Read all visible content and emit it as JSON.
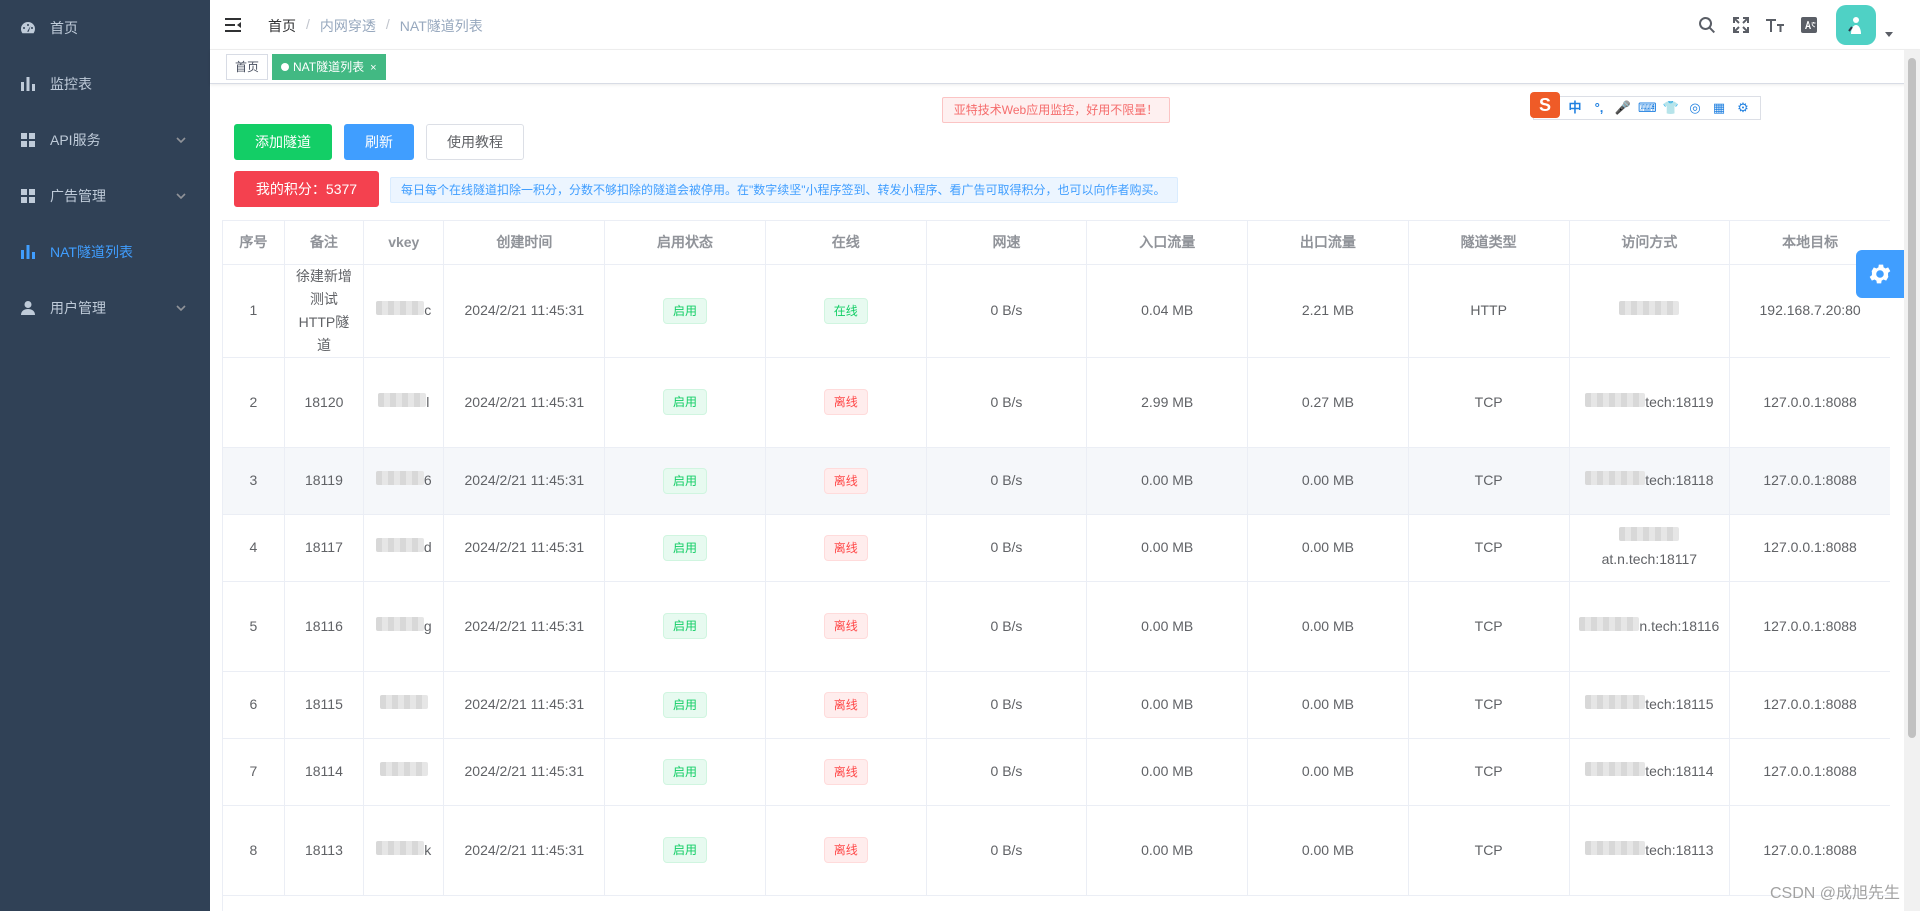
{
  "sidebar": {
    "items": [
      {
        "label": "首页",
        "icon": "dashboard-icon",
        "has_children": false,
        "active": false
      },
      {
        "label": "监控表",
        "icon": "bar-chart-icon",
        "has_children": false,
        "active": false
      },
      {
        "label": "API服务",
        "icon": "grid-icon",
        "has_children": true,
        "active": false
      },
      {
        "label": "广告管理",
        "icon": "grid-icon",
        "has_children": true,
        "active": false
      },
      {
        "label": "NAT隧道列表",
        "icon": "bar-chart-icon",
        "has_children": false,
        "active": true
      },
      {
        "label": "用户管理",
        "icon": "user-icon",
        "has_children": true,
        "active": false
      }
    ]
  },
  "header": {
    "breadcrumb": [
      "首页",
      "内网穿透",
      "NAT隧道列表"
    ],
    "tools": [
      "search-icon",
      "fullscreen-icon",
      "font-size-icon",
      "translate-icon"
    ]
  },
  "tags": [
    {
      "label": "首页",
      "active": false
    },
    {
      "label": "NAT隧道列表",
      "active": true,
      "close": "×"
    }
  ],
  "notices": {
    "ad": "亚特技术Web应用监控，好用不限量！",
    "info": "每日每个在线隧道扣除一积分，分数不够扣除的隧道会被停用。在\"数字续坚\"小程序签到、转发小程序、看广告可取得积分，也可以向作者购买。"
  },
  "ime": {
    "logo": "S",
    "items": [
      "中",
      "°,",
      "🎤",
      "⌨",
      "👕",
      "◎",
      "▦",
      "⚙"
    ]
  },
  "toolbar": {
    "add_label": "添加隧道",
    "refresh_label": "刷新",
    "tutorial_label": "使用教程",
    "points_label": "我的积分：5377"
  },
  "table": {
    "columns": [
      "序号",
      "备注",
      "vkey",
      "创建时间",
      "启用状态",
      "在线",
      "网速",
      "入口流量",
      "出口流量",
      "隧道类型",
      "访问方式",
      "本地目标"
    ],
    "rows": [
      {
        "index": "1",
        "remark": "徐建新增测试HTTP隧道",
        "vkey": "c",
        "created": "2024/2/21 11:45:31",
        "enabled": "启用",
        "online": "在线",
        "online_ok": true,
        "speed": "0 B/s",
        "in": "0.04 MB",
        "out": "2.21 MB",
        "type": "HTTP",
        "access": "",
        "target": "192.168.7.20:80"
      },
      {
        "index": "2",
        "remark": "18120",
        "vkey": "l",
        "created": "2024/2/21 11:45:31",
        "enabled": "启用",
        "online": "离线",
        "online_ok": false,
        "speed": "0 B/s",
        "in": "2.99 MB",
        "out": "0.27 MB",
        "type": "TCP",
        "access": "tech:18119",
        "target": "127.0.0.1:8088"
      },
      {
        "index": "3",
        "remark": "18119",
        "vkey": "6",
        "created": "2024/2/21 11:45:31",
        "enabled": "启用",
        "online": "离线",
        "online_ok": false,
        "speed": "0 B/s",
        "in": "0.00 MB",
        "out": "0.00 MB",
        "type": "TCP",
        "access": "tech:18118",
        "target": "127.0.0.1:8088"
      },
      {
        "index": "4",
        "remark": "18117",
        "vkey": "d",
        "created": "2024/2/21 11:45:31",
        "enabled": "启用",
        "online": "离线",
        "online_ok": false,
        "speed": "0 B/s",
        "in": "0.00 MB",
        "out": "0.00 MB",
        "type": "TCP",
        "access": "at.n.tech:18117",
        "target": "127.0.0.1:8088"
      },
      {
        "index": "5",
        "remark": "18116",
        "vkey": "g",
        "created": "2024/2/21 11:45:31",
        "enabled": "启用",
        "online": "离线",
        "online_ok": false,
        "speed": "0 B/s",
        "in": "0.00 MB",
        "out": "0.00 MB",
        "type": "TCP",
        "access": "n.tech:18116",
        "target": "127.0.0.1:8088"
      },
      {
        "index": "6",
        "remark": "18115",
        "vkey": "",
        "created": "2024/2/21 11:45:31",
        "enabled": "启用",
        "online": "离线",
        "online_ok": false,
        "speed": "0 B/s",
        "in": "0.00 MB",
        "out": "0.00 MB",
        "type": "TCP",
        "access": "tech:18115",
        "target": "127.0.0.1:8088"
      },
      {
        "index": "7",
        "remark": "18114",
        "vkey": "",
        "created": "2024/2/21 11:45:31",
        "enabled": "启用",
        "online": "离线",
        "online_ok": false,
        "speed": "0 B/s",
        "in": "0.00 MB",
        "out": "0.00 MB",
        "type": "TCP",
        "access": "tech:18114",
        "target": "127.0.0.1:8088"
      },
      {
        "index": "8",
        "remark": "18113",
        "vkey": "k",
        "created": "2024/2/21 11:45:31",
        "enabled": "启用",
        "online": "离线",
        "online_ok": false,
        "speed": "0 B/s",
        "in": "0.00 MB",
        "out": "0.00 MB",
        "type": "TCP",
        "access": "tech:18113",
        "target": "127.0.0.1:8088"
      }
    ]
  },
  "watermark": "CSDN @成旭先生"
}
